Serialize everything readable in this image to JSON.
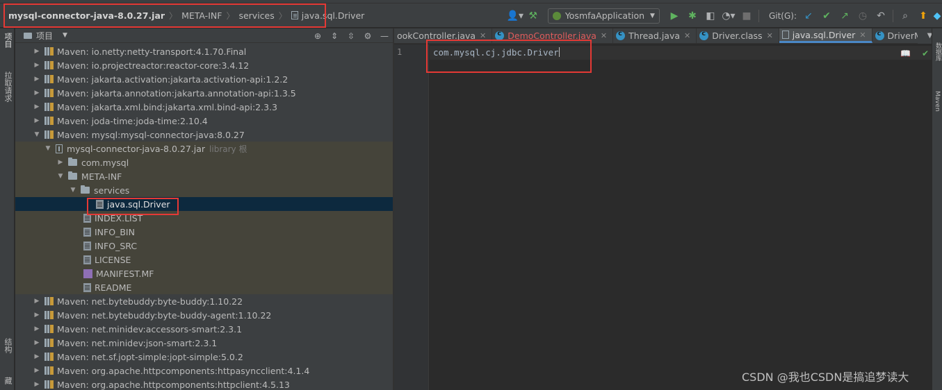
{
  "breadcrumb": {
    "jar": "mysql-connector-java-8.0.27.jar",
    "meta_inf": "META-INF",
    "services": "services",
    "file": "java.sql.Driver"
  },
  "toolbar": {
    "run_config": "YosmfaApplication",
    "git_label": "Git(G):"
  },
  "left_strip": {
    "project": "项目",
    "pull_requests": "拉取请求",
    "structure": "结构",
    "bookmarks": "收藏"
  },
  "project_panel": {
    "title": "项目"
  },
  "tree": [
    {
      "label": "Maven: io.netty:netty-transport:4.1.70.Final"
    },
    {
      "label": "Maven: io.projectreactor:reactor-core:3.4.12"
    },
    {
      "label": "Maven: jakarta.activation:jakarta.activation-api:1.2.2"
    },
    {
      "label": "Maven: jakarta.annotation:jakarta.annotation-api:1.3.5"
    },
    {
      "label": "Maven: jakarta.xml.bind:jakarta.xml.bind-api:2.3.3"
    },
    {
      "label": "Maven: joda-time:joda-time:2.10.4"
    },
    {
      "label": "Maven: mysql:mysql-connector-java:8.0.27"
    },
    {
      "label": "mysql-connector-java-8.0.27.jar",
      "suffix": "library 根"
    },
    {
      "label": "com.mysql"
    },
    {
      "label": "META-INF"
    },
    {
      "label": "services"
    },
    {
      "label": "java.sql.Driver"
    },
    {
      "label": "INDEX.LIST"
    },
    {
      "label": "INFO_BIN"
    },
    {
      "label": "INFO_SRC"
    },
    {
      "label": "LICENSE"
    },
    {
      "label": "MANIFEST.MF"
    },
    {
      "label": "README"
    },
    {
      "label": "Maven: net.bytebuddy:byte-buddy:1.10.22"
    },
    {
      "label": "Maven: net.bytebuddy:byte-buddy-agent:1.10.22"
    },
    {
      "label": "Maven: net.minidev:accessors-smart:2.3.1"
    },
    {
      "label": "Maven: net.minidev:json-smart:2.3.1"
    },
    {
      "label": "Maven: net.sf.jopt-simple:jopt-simple:5.0.2"
    },
    {
      "label": "Maven: org.apache.httpcomponents:httpasyncclient:4.1.4"
    },
    {
      "label": "Maven: org.apache.httpcomponents:httpclient:4.5.13"
    }
  ],
  "tabs": [
    {
      "label": "ookController.java"
    },
    {
      "label": "DemoController.java"
    },
    {
      "label": "Thread.java"
    },
    {
      "label": "Driver.class"
    },
    {
      "label": "java.sql.Driver"
    },
    {
      "label": "DriverMa"
    }
  ],
  "editor": {
    "line_number": "1",
    "code": "com.mysql.cj.jdbc.Driver"
  },
  "right_strip": {
    "database": "数据库",
    "maven": "Maven"
  },
  "watermark": "CSDN @我也CSDN是搞追梦读大"
}
